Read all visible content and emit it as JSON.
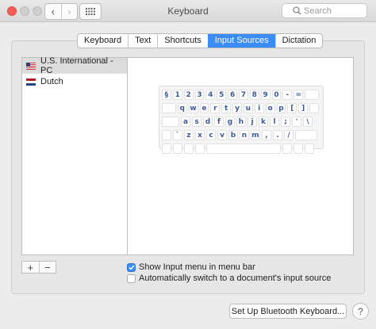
{
  "window": {
    "title": "Keyboard",
    "controls": [
      "close",
      "minimize",
      "zoom"
    ],
    "nav": {
      "back_icon": "‹",
      "forward_icon": "›"
    },
    "show_all_icon": "grid-icon",
    "search_placeholder": "Search"
  },
  "tabs": [
    {
      "label": "Keyboard",
      "active": false
    },
    {
      "label": "Text",
      "active": false
    },
    {
      "label": "Shortcuts",
      "active": false
    },
    {
      "label": "Input Sources",
      "active": true
    },
    {
      "label": "Dictation",
      "active": false
    }
  ],
  "sources": [
    {
      "label": "U.S. International - PC",
      "flag": "us-flag-icon",
      "selected": true
    },
    {
      "label": "Dutch",
      "flag": "nl-flag-icon",
      "selected": false
    }
  ],
  "keyboard_layout": {
    "rows": [
      [
        "§",
        "1",
        "2",
        "3",
        "4",
        "5",
        "6",
        "7",
        "8",
        "9",
        "0",
        "-",
        "="
      ],
      [
        "q",
        "w",
        "e",
        "r",
        "t",
        "y",
        "u",
        "i",
        "o",
        "p",
        "[",
        "]"
      ],
      [
        "a",
        "s",
        "d",
        "f",
        "g",
        "h",
        "j",
        "k",
        "l",
        ";",
        "'",
        "\\"
      ],
      [
        "`",
        "z",
        "x",
        "c",
        "v",
        "b",
        "n",
        "m",
        ",",
        ".",
        "/"
      ]
    ]
  },
  "list_controls": {
    "add": "+",
    "remove": "−"
  },
  "options": {
    "show_menu": {
      "label": "Show Input menu in menu bar",
      "checked": true
    },
    "auto_switch": {
      "label": "Automatically switch to a document's input source",
      "checked": false
    }
  },
  "buttons": {
    "bluetooth": "Set Up Bluetooth Keyboard...",
    "help": "?"
  },
  "colors": {
    "accent": "#3b8cf5",
    "close": "#fc5f57",
    "key_text": "#3d5a9c"
  }
}
